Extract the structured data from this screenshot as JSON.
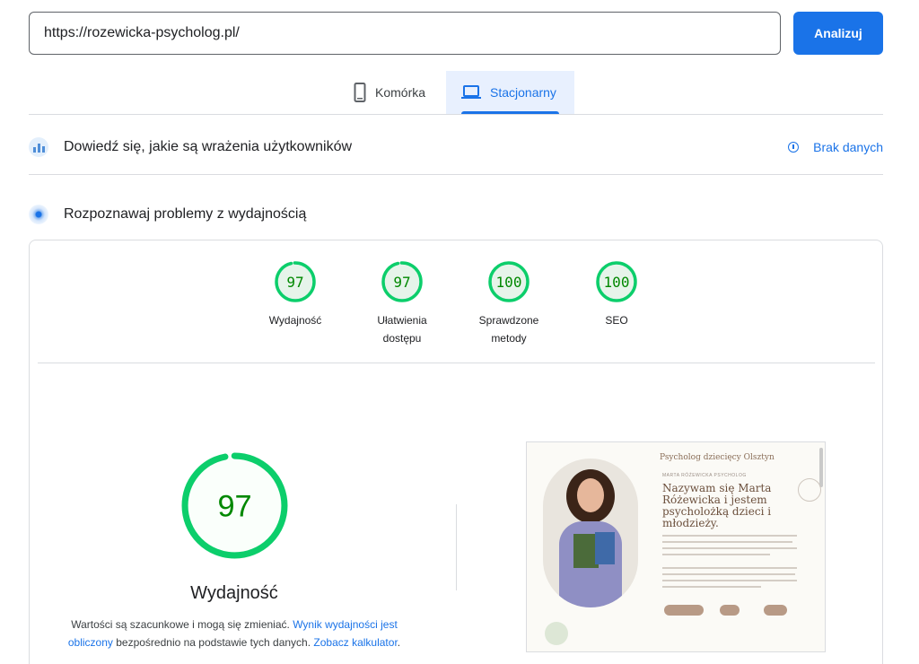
{
  "search": {
    "url_value": "https://rozewicka-psycholog.pl/",
    "analyze_label": "Analizuj"
  },
  "tabs": {
    "mobile_label": "Komórka",
    "desktop_label": "Stacjonarny"
  },
  "crux": {
    "title": "Dowiedź się, jakie są wrażenia użytkowników",
    "status_label": "Brak danych"
  },
  "lab": {
    "title": "Rozpoznawaj problemy z wydajnością"
  },
  "scores": [
    {
      "value": "97",
      "label": "Wydajność",
      "score": 97
    },
    {
      "value": "97",
      "label": "Ułatwienia dostępu",
      "score": 97
    },
    {
      "value": "100",
      "label": "Sprawdzone metody",
      "score": 100
    },
    {
      "value": "100",
      "label": "SEO",
      "score": 100
    }
  ],
  "performance": {
    "score_value": "97",
    "score": 97,
    "title": "Wydajność",
    "disclaimer_prefix": "Wartości są szacunkowe i mogą się zmieniać. ",
    "disclaimer_link1": "Wynik wydajności jest obliczony",
    "disclaimer_middle": " bezpośrednio na podstawie tych danych. ",
    "disclaimer_link2": "Zobacz kalkulator",
    "disclaimer_suffix": "."
  },
  "thumbnail": {
    "brand": "Psycholog dziecięcy Olsztyn",
    "small": "MARTA RÓŻEWICKA PSYCHOLOG",
    "hero": "Nazywam się Marta Różewicka i jestem psycholożką dzieci i młodzieży."
  },
  "colors": {
    "accent": "#1a73e8",
    "pass_green": "#0cce6b",
    "pass_text": "#008800",
    "pass_fill": "#e6f4ea"
  },
  "icons": {
    "mobile": "smartphone-icon",
    "desktop": "laptop-icon",
    "info": "info-icon"
  }
}
